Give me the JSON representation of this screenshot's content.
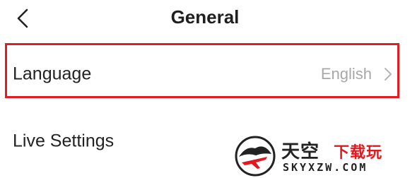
{
  "header": {
    "title": "General",
    "back_icon": "chevron-left-icon"
  },
  "settings": {
    "language": {
      "label": "Language",
      "value": "English",
      "chevron_icon": "chevron-right-icon",
      "highlighted": true,
      "highlight_color": "#e21c23"
    },
    "live_settings": {
      "label": "Live Settings"
    }
  },
  "colors": {
    "title": "#1f1f1f",
    "label": "#222222",
    "value": "#a8a8a8",
    "chevron": "#b5b5b5",
    "background": "#ffffff"
  },
  "watermark": {
    "brand_main": "天空",
    "brand_accent": "下载玩",
    "domain": "SKYXZW.COM"
  }
}
